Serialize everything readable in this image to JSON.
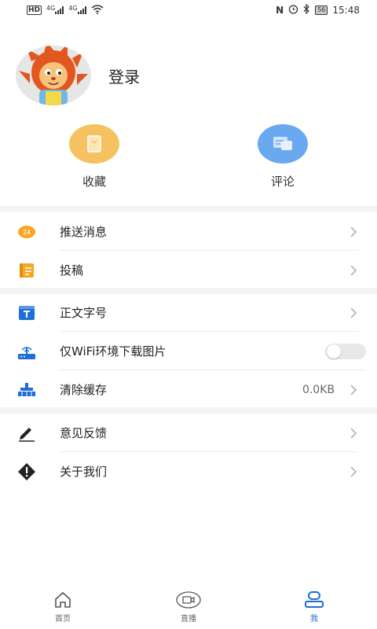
{
  "status_bar": {
    "left": {
      "hd": "HD",
      "net1": "4G",
      "net2": "4G"
    },
    "right": {
      "battery": "56",
      "time": "15:48"
    }
  },
  "profile": {
    "login_label": "登录"
  },
  "quick_actions": [
    {
      "label": "收藏",
      "icon": "bookmark-icon",
      "color": "#f6c160"
    },
    {
      "label": "评论",
      "icon": "comment-icon",
      "color": "#6aa9f0"
    }
  ],
  "menu_group1": [
    {
      "label": "推送消息",
      "icon": "push-24-icon"
    },
    {
      "label": "投稿",
      "icon": "contribute-icon"
    }
  ],
  "menu_group2": [
    {
      "label": "正文字号",
      "icon": "font-size-icon"
    },
    {
      "label": "仅WiFi环境下载图片",
      "icon": "wifi-router-icon",
      "toggle": "off"
    },
    {
      "label": "清除缓存",
      "icon": "clear-cache-icon",
      "value": "0.0KB"
    }
  ],
  "menu_group3": [
    {
      "label": "意见反馈",
      "icon": "pen-icon"
    },
    {
      "label": "关于我们",
      "icon": "info-icon"
    }
  ],
  "tabs": [
    {
      "label": "首页",
      "icon": "home-icon"
    },
    {
      "label": "直播",
      "icon": "video-icon"
    },
    {
      "label": "我",
      "icon": "user-icon",
      "active": true
    }
  ],
  "colors": {
    "accent": "#1a6fd1",
    "orange": "#f5a623",
    "blue": "#1e6fd9"
  }
}
